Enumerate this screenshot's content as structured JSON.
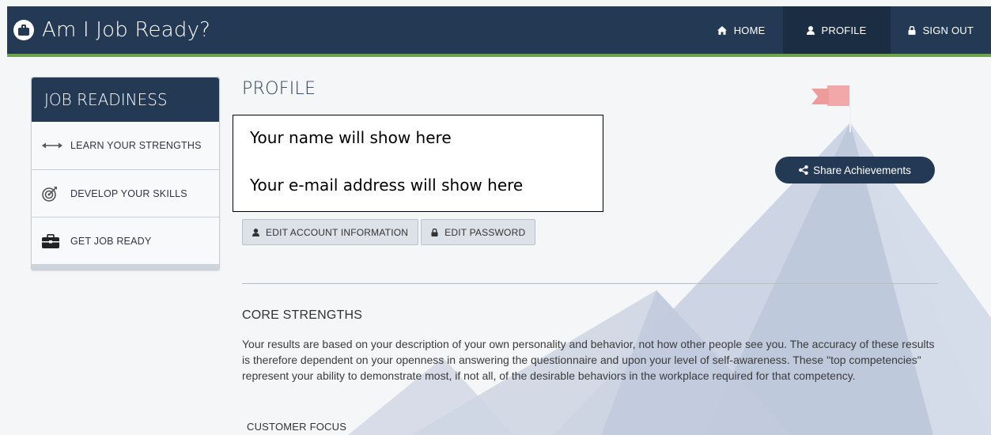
{
  "app": {
    "title": "Am I Job Ready?"
  },
  "nav": {
    "items": [
      {
        "label": "HOME",
        "icon": "home-icon"
      },
      {
        "label": "PROFILE",
        "icon": "user-icon"
      },
      {
        "label": "SIGN OUT",
        "icon": "lock-icon"
      }
    ],
    "active": "PROFILE"
  },
  "sidebar": {
    "title": "JOB READINESS",
    "items": [
      {
        "label": "LEARN YOUR STRENGTHS",
        "icon": "arrows-horizontal-icon"
      },
      {
        "label": "DEVELOP YOUR SKILLS",
        "icon": "target-icon"
      },
      {
        "label": "GET JOB READY",
        "icon": "briefcase-icon"
      }
    ]
  },
  "profile": {
    "title": "PROFILE",
    "name_placeholder": "Your name will show here",
    "email_placeholder": "Your e-mail address will show here",
    "edit_account_label": "EDIT ACCOUNT INFORMATION",
    "edit_password_label": "EDIT PASSWORD",
    "share_label": "Share Achievements"
  },
  "core": {
    "title": "CORE STRENGTHS",
    "text": "Your results are based on your description of your own personality and behavior, not how other people see you. The accuracy of these results is therefore dependent on your openness in answering the questionnaire and upon your level of self-awareness. These \"top competencies\" represent your ability to demonstrate most, if not all, of the desirable behaviors in the workplace required for that competency.",
    "first_item": "CUSTOMER FOCUS"
  },
  "colors": {
    "navbar": "#243a54",
    "accent_green": "#6ea24b",
    "flag": "#f2a8a8",
    "mountain": "#c9d2e3"
  }
}
